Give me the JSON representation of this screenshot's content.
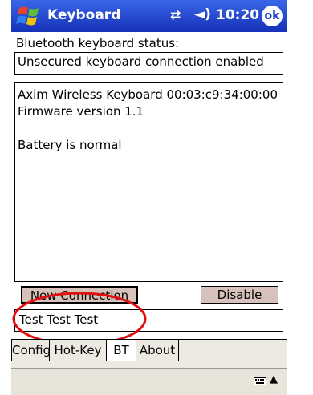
{
  "titlebar": {
    "title": "Keyboard",
    "time": "10:20",
    "ok_label": "ok",
    "icons": [
      "windows-start-icon",
      "connectivity-icon",
      "volume-icon"
    ]
  },
  "status": {
    "label": "Bluetooth keyboard status:",
    "value": "Unsecured keyboard connection enabled"
  },
  "info": {
    "lines": [
      "Axim Wireless Keyboard 00:03:c9:34:00:00",
      "Firmware version 1.1",
      "",
      "Battery is normal"
    ]
  },
  "buttons": {
    "new_connection": "New Connection",
    "disable": "Disable"
  },
  "test_input": {
    "value": "Test Test Test"
  },
  "tabs": [
    {
      "label": "Config",
      "active": false
    },
    {
      "label": "Hot-Key",
      "active": false
    },
    {
      "label": "BT",
      "active": true
    },
    {
      "label": "About",
      "active": false
    }
  ],
  "colors": {
    "titlebar": "#1a3fc8",
    "button_bg": "#d6c2ba",
    "annotation_oval": "#e01010"
  }
}
